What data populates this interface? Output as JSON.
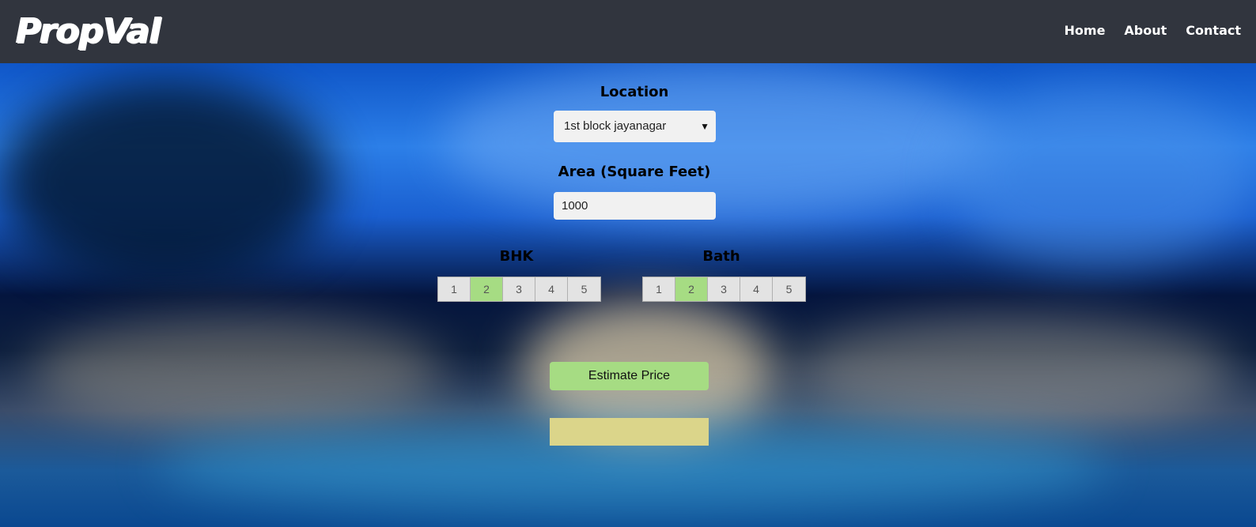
{
  "header": {
    "logo_text": "PropVal",
    "nav": [
      {
        "label": "Home"
      },
      {
        "label": "About"
      },
      {
        "label": "Contact"
      }
    ]
  },
  "form": {
    "location": {
      "label": "Location",
      "selected": "1st block jayanagar"
    },
    "area": {
      "label": "Area (Square Feet)",
      "value": "1000"
    },
    "bhk": {
      "label": "BHK",
      "options": [
        "1",
        "2",
        "3",
        "4",
        "5"
      ],
      "selected": "2"
    },
    "bath": {
      "label": "Bath",
      "options": [
        "1",
        "2",
        "3",
        "4",
        "5"
      ],
      "selected": "2"
    },
    "estimate_button": "Estimate Price",
    "result": ""
  },
  "colors": {
    "navbar": "#31353e",
    "active_segment": "#a6dc83",
    "button": "#a6dc83",
    "result_box": "#dbd58a"
  }
}
